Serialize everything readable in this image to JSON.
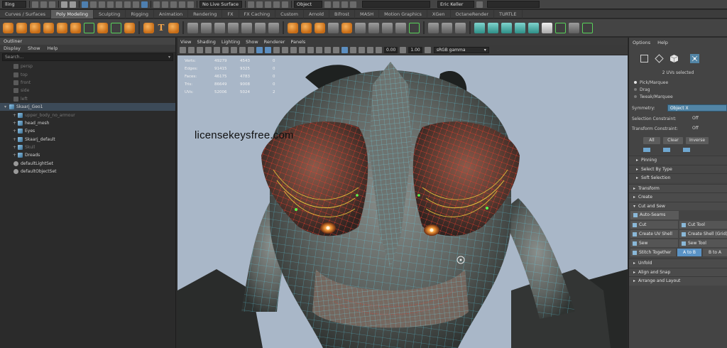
{
  "statusbar": {
    "mode_menu": "lling",
    "live_surface": "No Live Surface",
    "object_field": "Object  ",
    "user": "Eric Keller"
  },
  "shelf_tabs": [
    "Curves / Surfaces",
    "Poly Modeling",
    "Sculpting",
    "Rigging",
    "Animation",
    "Rendering",
    "FX",
    "FX Caching",
    "Custom",
    "Arnold",
    "Bifrost",
    "MASH",
    "Motion Graphics",
    "XGen",
    "OctaneRender",
    "TURTLE"
  ],
  "shelf_text_icon": "T",
  "outliner": {
    "title": "Outliner",
    "menu": [
      "Display",
      "Show",
      "Help"
    ],
    "search_placeholder": "Search...",
    "items": [
      {
        "label": "persp",
        "dim": true,
        "indent": 1,
        "icon": "cam"
      },
      {
        "label": "top",
        "dim": true,
        "indent": 1,
        "icon": "cam"
      },
      {
        "label": "front",
        "dim": true,
        "indent": 1,
        "icon": "cam"
      },
      {
        "label": "side",
        "dim": true,
        "indent": 1,
        "icon": "cam"
      },
      {
        "label": "left",
        "dim": true,
        "indent": 1,
        "icon": "cam"
      },
      {
        "label": "Skaarj_Geo1",
        "dim": false,
        "indent": 0,
        "icon": "mesh",
        "selected": true,
        "exp": "▾"
      },
      {
        "label": "upper_body_no_armour",
        "dim": true,
        "indent": 2,
        "icon": "mesh",
        "exp": "+"
      },
      {
        "label": "head_mesh",
        "dim": false,
        "indent": 2,
        "icon": "mesh",
        "exp": "+"
      },
      {
        "label": "Eyes",
        "dim": false,
        "indent": 2,
        "icon": "mesh",
        "exp": "+"
      },
      {
        "label": "Skaarj_default",
        "dim": false,
        "indent": 2,
        "icon": "mesh",
        "exp": "+"
      },
      {
        "label": "Skull",
        "dim": true,
        "indent": 2,
        "icon": "mesh",
        "exp": "+"
      },
      {
        "label": "Dreads",
        "dim": false,
        "indent": 2,
        "icon": "mesh",
        "exp": "+"
      },
      {
        "label": "defaultLightSet",
        "dim": false,
        "indent": 1,
        "icon": "set"
      },
      {
        "label": "defaultObjectSet",
        "dim": false,
        "indent": 1,
        "icon": "set"
      }
    ]
  },
  "viewport": {
    "menu": [
      "View",
      "Shading",
      "Lighting",
      "Show",
      "Renderer",
      "Panels"
    ],
    "field_a": "0.00",
    "field_b": "1.00",
    "color_space": "sRGB gamma",
    "hud": [
      {
        "label": "Verts:",
        "v1": "49279",
        "v2": "4543",
        "v3": "0"
      },
      {
        "label": "Edges:",
        "v1": "91415",
        "v2": "9325",
        "v3": "0"
      },
      {
        "label": "Faces:",
        "v1": "46175",
        "v2": "4783",
        "v3": "0"
      },
      {
        "label": "Tris:",
        "v1": "86649",
        "v2": "9008",
        "v3": "0"
      },
      {
        "label": "UVs:",
        "v1": "52006",
        "v2": "5024",
        "v3": "2"
      }
    ],
    "watermark": "licensekeysfree.com"
  },
  "right_panel": {
    "menu": [
      "Options",
      "Help"
    ],
    "uv_status": "2 UVs selected",
    "tools": [
      {
        "label": "Pick/Marquee",
        "on": true
      },
      {
        "label": "Drag",
        "on": false
      },
      {
        "label": "Tweak/Marquee",
        "on": false
      }
    ],
    "symmetry_label": "Symmetry:",
    "symmetry_value": "Object X",
    "selection_constraint_label": "Selection Constraint:",
    "selection_constraint_value": "Off",
    "transform_constraint_label": "Transform Constraint:",
    "transform_constraint_value": "Off",
    "btn_all": "All",
    "btn_clear": "Clear",
    "btn_inverse": "Inverse",
    "sections_top": [
      "Pinning",
      "Select By Type",
      "Soft Selection"
    ],
    "sections_mid": [
      "Transform",
      "Create"
    ],
    "cut_and_sew": "Cut and Sew",
    "auto_seams": "Auto-Seams",
    "cut": "Cut",
    "cut_tool": "Cut Tool",
    "create_uv_shell": "Create UV Shell",
    "create_shell_grid": "Create Shell (Grid)",
    "sew": "Sew",
    "sew_tool": "Sew Tool",
    "stitch_together": "Stitch Together",
    "a_to_b": "A to B",
    "b_to_a": "B to A",
    "sections_bottom": [
      "Unfold",
      "Align and Snap",
      "Arrange and Layout"
    ]
  },
  "colors": {
    "accent_blue": "#5285a6",
    "wire_cyan": "#5ed6f0",
    "selection_red": "#e43c2e",
    "shelf_orange": "#f3a44a"
  }
}
